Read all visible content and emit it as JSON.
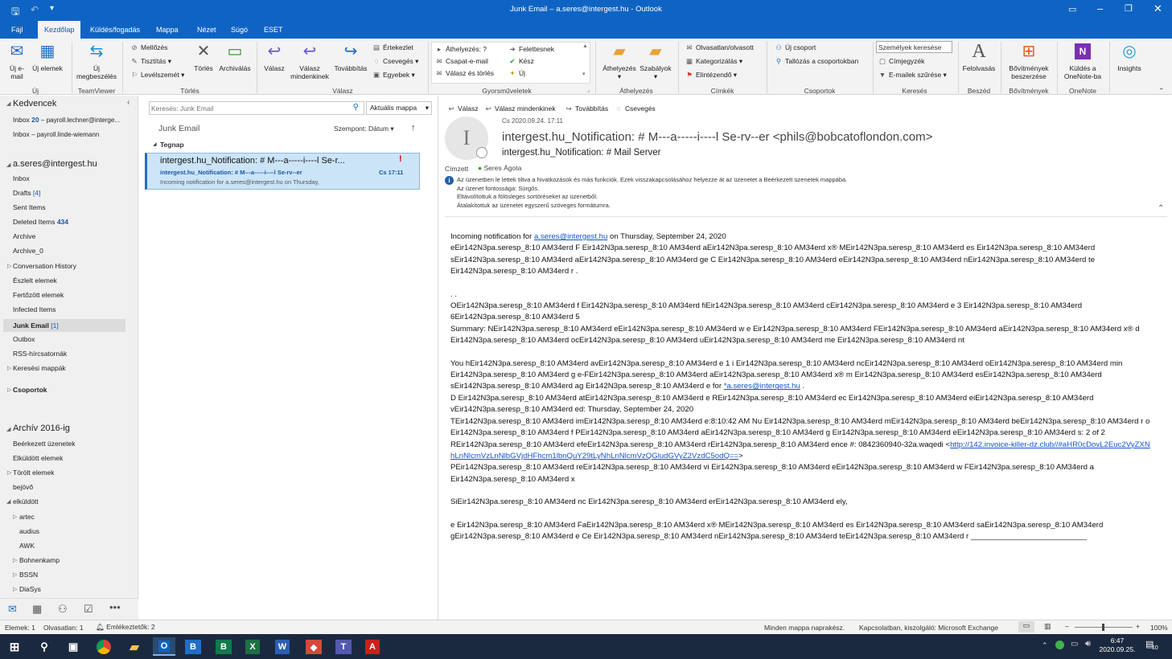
{
  "window": {
    "title": "Junk Email – a.seres@intergest.hu - Outlook"
  },
  "ribbon_tabs": [
    "Fájl",
    "Kezdőlap",
    "Küldés/fogadás",
    "Mappa",
    "Nézet",
    "Súgó",
    "ESET"
  ],
  "ribbon": {
    "uj": {
      "new_email": "Új e-mail",
      "new_items": "Új elemek",
      "group": "Új"
    },
    "teamviewer": {
      "meeting": "Új megbeszélés",
      "group": "TeamViewer"
    },
    "torles": {
      "ignore": "Mellőzés",
      "clean": "Tisztítás",
      "junk": "Levélszemét",
      "delete": "Törlés",
      "archive": "Archiválás",
      "group": "Törlés"
    },
    "valasz": {
      "reply": "Válasz",
      "reply_all": "Válasz mindenkinek",
      "forward": "Továbbítás",
      "meeting": "Értekezlet",
      "im": "Csevegés",
      "more": "Egyebek",
      "group": "Válasz"
    },
    "gyors": {
      "move": "Áthelyezés: ?",
      "team": "Csapat-e-mail",
      "reply_delete": "Válasz és törlés",
      "manager": "Felettesnek",
      "done": "Kész",
      "new": "Új",
      "group": "Gyorsműveletek"
    },
    "athely": {
      "move": "Áthelyezés",
      "rules": "Szabályok",
      "group": "Áthelyezés"
    },
    "cimkek": {
      "unread": "Olvasatlan/olvasott",
      "categorize": "Kategorizálás",
      "followup": "Elintézendő",
      "group": "Címkék"
    },
    "csoportok": {
      "new_group": "Új csoport",
      "browse": "Tallózás a csoportokban",
      "group": "Csoportok"
    },
    "kereses": {
      "search_people": "Személyek keresése",
      "address_book": "Címjegyzék",
      "filter": "E-mailek szűrése",
      "group": "Keresés"
    },
    "beszed": {
      "read": "Felolvasás",
      "group": "Beszéd"
    },
    "bovit": {
      "get_addins": "Bővítmények beszerzése",
      "group": "Bővítmények"
    },
    "onenote": {
      "send": "Küldés a OneNote-ba",
      "group": "OneNote"
    },
    "insights": "Insights"
  },
  "nav": {
    "favorites": "Kedvencek",
    "fav_items": [
      {
        "label": "Inbox",
        "count": "20",
        "extra": "– payroll.lechner@interge..."
      },
      {
        "label": "Inbox",
        "count": "",
        "extra": "– payroll.linde-wiemann"
      }
    ],
    "account": "a.seres@intergest.hu",
    "folders": [
      {
        "label": "Inbox",
        "count": ""
      },
      {
        "label": "Drafts",
        "count": "[4]"
      },
      {
        "label": "Sent Items",
        "count": ""
      },
      {
        "label": "Deleted Items",
        "count": "434"
      },
      {
        "label": "Archive",
        "count": ""
      },
      {
        "label": "Archive_0",
        "count": ""
      },
      {
        "label": "Conversation History",
        "count": ""
      },
      {
        "label": "Észlelt elemek",
        "count": ""
      },
      {
        "label": "Fertőzött elemek",
        "count": ""
      },
      {
        "label": "Infected Items",
        "count": ""
      },
      {
        "label": "Junk Email",
        "count": "[1]"
      },
      {
        "label": "Outbox",
        "count": ""
      },
      {
        "label": "RSS-hírcsatornák",
        "count": ""
      },
      {
        "label": "Keresési mappák",
        "count": ""
      }
    ],
    "groups": "Csoportok",
    "archive_header": "Archív 2016-ig",
    "archive_items": [
      "Beérkezett üzenetek",
      "Elküldött elemek",
      "Törölt elemek",
      "bejövő",
      "elküldött"
    ],
    "sub_items": [
      "artec",
      "audius",
      "AWK",
      "Bohnenkamp",
      "BSSN",
      "DiaSys"
    ]
  },
  "list": {
    "search_placeholder": "Keresés: Junk Email",
    "scope": "Aktuális mappa",
    "folder": "Junk Email",
    "sort": "Szempont: Dátum",
    "group_header": "Tegnap",
    "message": {
      "subject": "intergest.hu_Notification: # M---a-----i----l Se-r...",
      "sender_line": "intergest.hu_Notification: # M---a-----i----l Se-rv--er",
      "time": "Cs 17:11",
      "preview": "Incoming notification for a.seres@intergest.hu on Thursday,"
    }
  },
  "reading": {
    "actions": [
      "Válasz",
      "Válasz mindenkinek",
      "Továbbítás",
      "Csevegés"
    ],
    "date": "Cs 2020.09.24. 17:11",
    "avatar_letter": "I",
    "from": "intergest.hu_Notification: # M---a-----i----l Se-rv--er <phils@bobcatoflondon.com>",
    "subject": "intergest.hu_Notification: # Mail Server",
    "to_label": "Címzett",
    "to": "Seres Ágota",
    "info_lines": [
      "Az üzenetben le lettek tiltva a hivatkozások és más funkciók. Ezek visszakapcsolásához helyezze át az üzenetet a Beérkezett üzenetek mappába.",
      "Az üzenet fontossága: Sürgős.",
      "Eltávolítottuk a fölösleges sortöréseket az üzenetből.",
      "Átalakítottuk az üzenetet egyszerű szöveges formátumra."
    ],
    "body": {
      "p1_pre": "Incoming notification for ",
      "p1_link": "a.seres@intergest.hu",
      "p1_post": " on Thursday, September 24, 2020",
      "p1_rest": "eEir142N3pa.seresp_8:10 AM34erd F Eir142N3pa.seresp_8:10 AM34erd aEir142N3pa.seresp_8:10 AM34erd x® MEir142N3pa.seresp_8:10 AM34erd es Eir142N3pa.seresp_8:10 AM34erd sEir142N3pa.seresp_8:10 AM34erd aEir142N3pa.seresp_8:10 AM34erd ge C Eir142N3pa.seresp_8:10 AM34erd eEir142N3pa.seresp_8:10 AM34erd nEir142N3pa.seresp_8:10 AM34erd te Eir142N3pa.seresp_8:10 AM34erd r .",
      "dots": ". .",
      "p2": "OEir142N3pa.seresp_8:10 AM34erd f Eir142N3pa.seresp_8:10 AM34erd fiEir142N3pa.seresp_8:10 AM34erd cEir142N3pa.seresp_8:10 AM34erd e 3 Eir142N3pa.seresp_8:10 AM34erd 6Eir142N3pa.seresp_8:10 AM34erd 5",
      "p3": "Summary: NEir142N3pa.seresp_8:10 AM34erd eEir142N3pa.seresp_8:10 AM34erd w e Eir142N3pa.seresp_8:10 AM34erd FEir142N3pa.seresp_8:10 AM34erd aEir142N3pa.seresp_8:10 AM34erd x® d Eir142N3pa.seresp_8:10 AM34erd ocEir142N3pa.seresp_8:10 AM34erd uEir142N3pa.seresp_8:10 AM34erd me Eir142N3pa.seresp_8:10 AM34erd nt",
      "p4_pre": "You hEir142N3pa.seresp_8:10 AM34erd avEir142N3pa.seresp_8:10 AM34erd e 1 i Eir142N3pa.seresp_8:10 AM34erd ncEir142N3pa.seresp_8:10 AM34erd oEir142N3pa.seresp_8:10 AM34erd min Eir142N3pa.seresp_8:10 AM34erd g e-FEir142N3pa.seresp_8:10 AM34erd aEir142N3pa.seresp_8:10 AM34erd x® m Eir142N3pa.seresp_8:10 AM34erd esEir142N3pa.seresp_8:10 AM34erd sEir142N3pa.seresp_8:10 AM34erd ag Eir142N3pa.seresp_8:10 AM34erd e for ",
      "p4_link": "*a.seres@intergest.hu",
      "p4_post": " .",
      "p5": "D Eir142N3pa.seresp_8:10 AM34erd atEir142N3pa.seresp_8:10 AM34erd e REir142N3pa.seresp_8:10 AM34erd ec Eir142N3pa.seresp_8:10 AM34erd eiEir142N3pa.seresp_8:10 AM34erd vEir142N3pa.seresp_8:10 AM34erd ed: Thursday, September 24, 2020",
      "p6": "TEir142N3pa.seresp_8:10 AM34erd imEir142N3pa.seresp_8:10 AM34erd e:8:10:42 AM Nu Eir142N3pa.seresp_8:10 AM34erd mEir142N3pa.seresp_8:10 AM34erd beEir142N3pa.seresp_8:10 AM34erd r o Eir142N3pa.seresp_8:10 AM34erd f PEir142N3pa.seresp_8:10 AM34erd aEir142N3pa.seresp_8:10 AM34erd g Eir142N3pa.seresp_8:10 AM34erd eEir142N3pa.seresp_8:10 AM34erd s: 2 of 2",
      "p7_pre": "REir142N3pa.seresp_8:10 AM34erd efeEir142N3pa.seresp_8:10 AM34erd rEir142N3pa.seresp_8:10 AM34erd ence #: 0842360940-32a.waqedi <",
      "p7_link": "http://142.invoice-killer-dz.club//#aHR0cDovL2Euc2VyZXNhLnNlcmVzLnNlbGVjdHFhcm1lbnQuY29tLyNhLnNlcmVzQGludGVyZ2VzdC5odQ==",
      "p7_post": ">",
      "p8": "PEir142N3pa.seresp_8:10 AM34erd reEir142N3pa.seresp_8:10 AM34erd vi Eir142N3pa.seresp_8:10 AM34erd eEir142N3pa.seresp_8:10 AM34erd w FEir142N3pa.seresp_8:10 AM34erd a Eir142N3pa.seresp_8:10 AM34erd x",
      "p9": "SiEir142N3pa.seresp_8:10 AM34erd nc Eir142N3pa.seresp_8:10 AM34erd erEir142N3pa.seresp_8:10 AM34erd ely,",
      "p10": "e Eir142N3pa.seresp_8:10 AM34erd FaEir142N3pa.seresp_8:10 AM34erd x® MEir142N3pa.seresp_8:10 AM34erd es Eir142N3pa.seresp_8:10 AM34erd saEir142N3pa.seresp_8:10 AM34erd gEir142N3pa.seresp_8:10 AM34erd e Ce Eir142N3pa.seresp_8:10 AM34erd nEir142N3pa.seresp_8:10 AM34erd teEir142N3pa.seresp_8:10 AM34erd r ___________________________"
    }
  },
  "status": {
    "items": "Elemek: 1",
    "unread": "Olvasatlan: 1",
    "reminders": "Emlékeztetők: 2",
    "sync": "Minden mappa naprakész.",
    "connection": "Kapcsolatban, kiszolgáló: Microsoft Exchange",
    "zoom": "100%"
  },
  "taskbar": {
    "time": "6:47",
    "date": "2020.09.25.",
    "notif": "10"
  },
  "colors": {
    "accent": "#0f64c3",
    "selection": "#cce4f7",
    "link": "#1155cc",
    "taskbar": "#1b2940"
  }
}
